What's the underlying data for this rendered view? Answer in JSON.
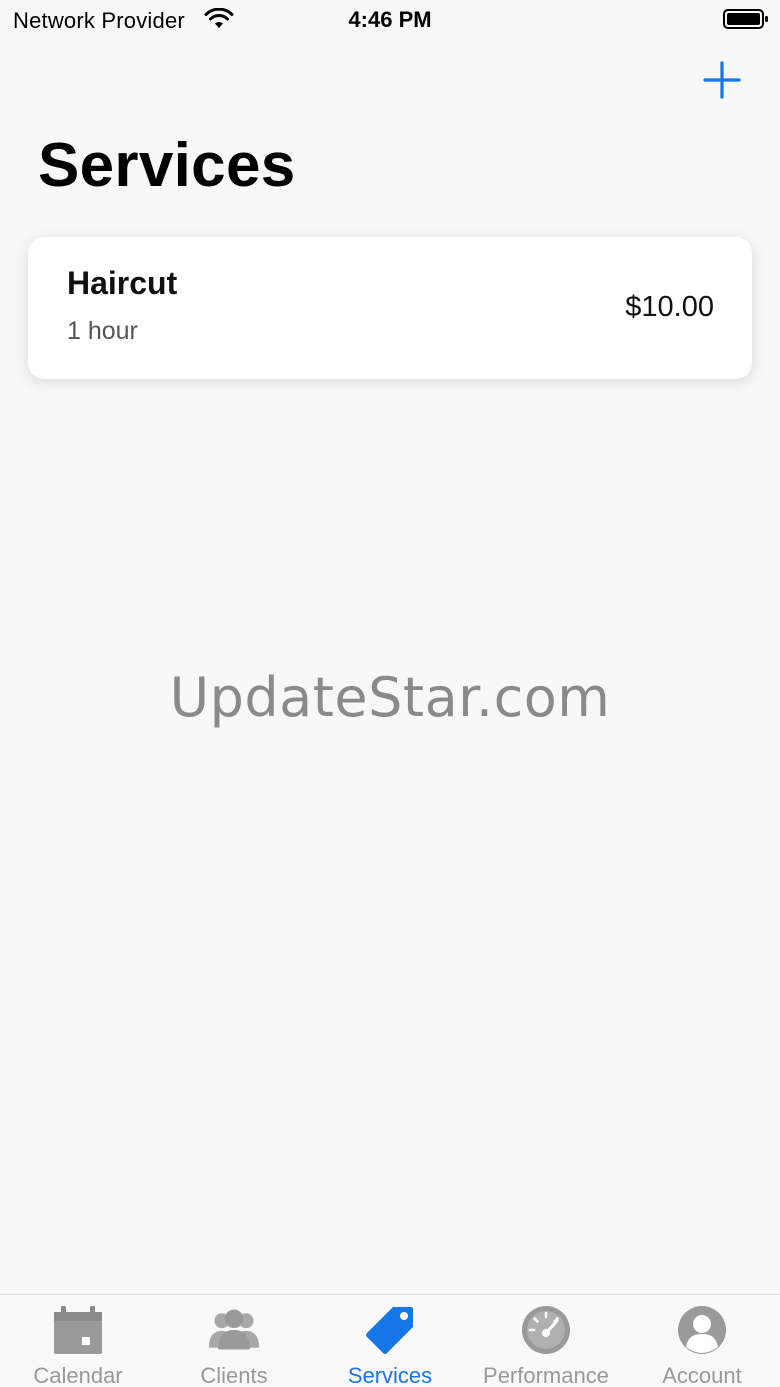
{
  "status_bar": {
    "carrier": "Network Provider",
    "time": "4:46 PM",
    "wifi_icon": "wifi-icon",
    "battery_icon": "battery-icon"
  },
  "nav": {
    "add_icon": "plus-icon",
    "title": "Services"
  },
  "services": [
    {
      "name": "Haircut",
      "duration": "1 hour",
      "price": "$10.00"
    }
  ],
  "watermark": "UpdateStar.com",
  "tab_bar": {
    "tabs": [
      {
        "label": "Calendar",
        "icon": "calendar-icon",
        "active": false
      },
      {
        "label": "Clients",
        "icon": "clients-icon",
        "active": false
      },
      {
        "label": "Services",
        "icon": "tag-icon",
        "active": true
      },
      {
        "label": "Performance",
        "icon": "speedometer-icon",
        "active": false
      },
      {
        "label": "Account",
        "icon": "account-icon",
        "active": false
      }
    ]
  },
  "colors": {
    "accent": "#1776e8",
    "inactive": "#999999",
    "background": "#f8f8f8"
  }
}
